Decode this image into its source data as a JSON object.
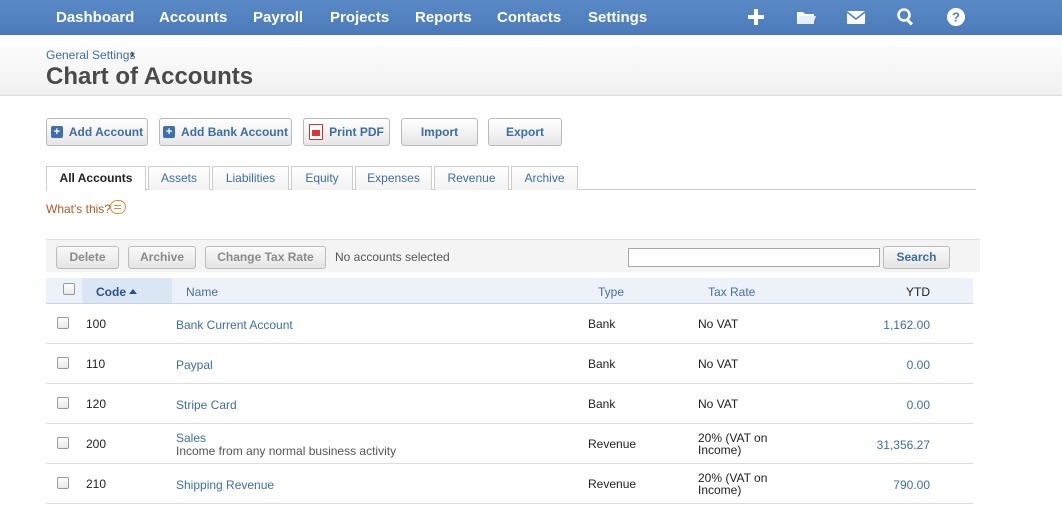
{
  "nav": {
    "items": [
      "Dashboard",
      "Accounts",
      "Payroll",
      "Projects",
      "Reports",
      "Contacts",
      "Settings"
    ],
    "icons": [
      "plus-icon",
      "folder-icon",
      "mail-icon",
      "search-icon",
      "help-icon"
    ]
  },
  "breadcrumb": {
    "label": "General Settings",
    "separator": "›"
  },
  "page_title": "Chart of Accounts",
  "actions": {
    "add_account": "Add Account",
    "add_bank_account": "Add Bank Account",
    "print_pdf": "Print PDF",
    "import": "Import",
    "export": "Export"
  },
  "tabs": [
    "All Accounts",
    "Assets",
    "Liabilities",
    "Equity",
    "Expenses",
    "Revenue",
    "Archive"
  ],
  "active_tab": "All Accounts",
  "whats_this": "What's this?",
  "toolbar": {
    "delete": "Delete",
    "archive": "Archive",
    "change_tax_rate": "Change Tax Rate",
    "status": "No accounts selected",
    "search_value": "",
    "search_button": "Search"
  },
  "table": {
    "headers": {
      "code": "Code",
      "name": "Name",
      "type": "Type",
      "tax_rate": "Tax Rate",
      "ytd": "YTD"
    },
    "rows": [
      {
        "code": "100",
        "name": "Bank Current Account",
        "description": "",
        "type": "Bank",
        "tax_rate_1": "No VAT",
        "tax_rate_2": "",
        "ytd": "1,162.00"
      },
      {
        "code": "110",
        "name": "Paypal",
        "description": "",
        "type": "Bank",
        "tax_rate_1": "No VAT",
        "tax_rate_2": "",
        "ytd": "0.00"
      },
      {
        "code": "120",
        "name": "Stripe Card",
        "description": "",
        "type": "Bank",
        "tax_rate_1": "No VAT",
        "tax_rate_2": "",
        "ytd": "0.00"
      },
      {
        "code": "200",
        "name": "Sales",
        "description": "Income from any normal business activity",
        "type": "Revenue",
        "tax_rate_1": "20% (VAT on",
        "tax_rate_2": "Income)",
        "ytd": "31,356.27"
      },
      {
        "code": "210",
        "name": "Shipping Revenue",
        "description": "",
        "type": "Revenue",
        "tax_rate_1": "20% (VAT on",
        "tax_rate_2": "Income)",
        "ytd": "790.00"
      }
    ]
  },
  "colors": {
    "nav_bg": "#4f81bd",
    "link": "#3b6ea5",
    "title": "#4a4a4a"
  }
}
